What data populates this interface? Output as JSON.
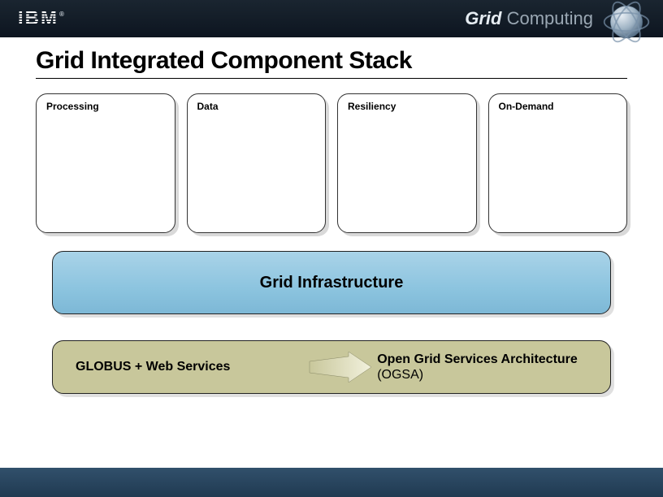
{
  "header": {
    "logo_text": "IBM",
    "brand_bold": "Grid",
    "brand_light": " Computing"
  },
  "title": "Grid Integrated Component Stack",
  "cards": {
    "c1": "Processing",
    "c2": "Data",
    "c3": "Resiliency",
    "c4": "On-Demand"
  },
  "infrastructure_label": "Grid Infrastructure",
  "bottom": {
    "left": "GLOBUS + Web Services",
    "right_bold": "Open Grid Services Architecture",
    "right_tail": " (OGSA)"
  }
}
